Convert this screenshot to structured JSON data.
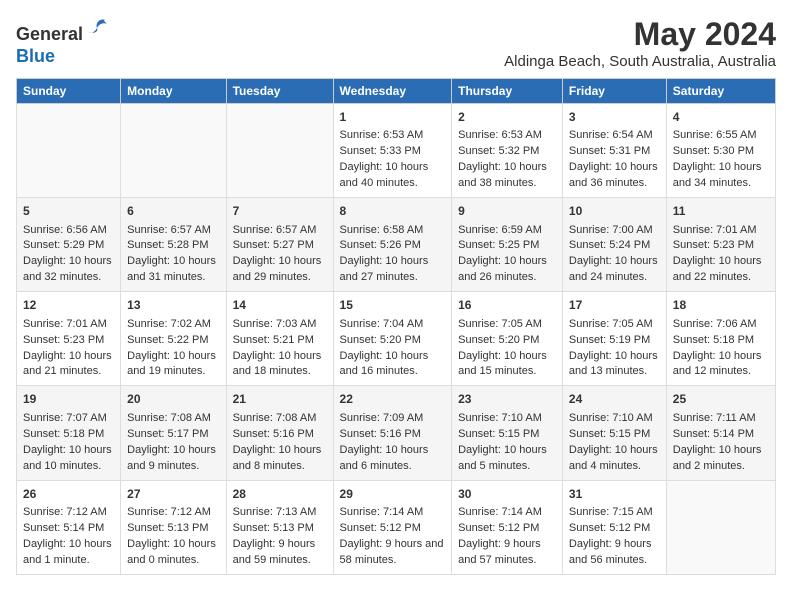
{
  "header": {
    "logo_line1": "General",
    "logo_line2": "Blue",
    "month_year": "May 2024",
    "location": "Aldinga Beach, South Australia, Australia"
  },
  "days_of_week": [
    "Sunday",
    "Monday",
    "Tuesday",
    "Wednesday",
    "Thursday",
    "Friday",
    "Saturday"
  ],
  "weeks": [
    [
      {
        "num": "",
        "sunrise": "",
        "sunset": "",
        "daylight": ""
      },
      {
        "num": "",
        "sunrise": "",
        "sunset": "",
        "daylight": ""
      },
      {
        "num": "",
        "sunrise": "",
        "sunset": "",
        "daylight": ""
      },
      {
        "num": "1",
        "sunrise": "Sunrise: 6:53 AM",
        "sunset": "Sunset: 5:33 PM",
        "daylight": "Daylight: 10 hours and 40 minutes."
      },
      {
        "num": "2",
        "sunrise": "Sunrise: 6:53 AM",
        "sunset": "Sunset: 5:32 PM",
        "daylight": "Daylight: 10 hours and 38 minutes."
      },
      {
        "num": "3",
        "sunrise": "Sunrise: 6:54 AM",
        "sunset": "Sunset: 5:31 PM",
        "daylight": "Daylight: 10 hours and 36 minutes."
      },
      {
        "num": "4",
        "sunrise": "Sunrise: 6:55 AM",
        "sunset": "Sunset: 5:30 PM",
        "daylight": "Daylight: 10 hours and 34 minutes."
      }
    ],
    [
      {
        "num": "5",
        "sunrise": "Sunrise: 6:56 AM",
        "sunset": "Sunset: 5:29 PM",
        "daylight": "Daylight: 10 hours and 32 minutes."
      },
      {
        "num": "6",
        "sunrise": "Sunrise: 6:57 AM",
        "sunset": "Sunset: 5:28 PM",
        "daylight": "Daylight: 10 hours and 31 minutes."
      },
      {
        "num": "7",
        "sunrise": "Sunrise: 6:57 AM",
        "sunset": "Sunset: 5:27 PM",
        "daylight": "Daylight: 10 hours and 29 minutes."
      },
      {
        "num": "8",
        "sunrise": "Sunrise: 6:58 AM",
        "sunset": "Sunset: 5:26 PM",
        "daylight": "Daylight: 10 hours and 27 minutes."
      },
      {
        "num": "9",
        "sunrise": "Sunrise: 6:59 AM",
        "sunset": "Sunset: 5:25 PM",
        "daylight": "Daylight: 10 hours and 26 minutes."
      },
      {
        "num": "10",
        "sunrise": "Sunrise: 7:00 AM",
        "sunset": "Sunset: 5:24 PM",
        "daylight": "Daylight: 10 hours and 24 minutes."
      },
      {
        "num": "11",
        "sunrise": "Sunrise: 7:01 AM",
        "sunset": "Sunset: 5:23 PM",
        "daylight": "Daylight: 10 hours and 22 minutes."
      }
    ],
    [
      {
        "num": "12",
        "sunrise": "Sunrise: 7:01 AM",
        "sunset": "Sunset: 5:23 PM",
        "daylight": "Daylight: 10 hours and 21 minutes."
      },
      {
        "num": "13",
        "sunrise": "Sunrise: 7:02 AM",
        "sunset": "Sunset: 5:22 PM",
        "daylight": "Daylight: 10 hours and 19 minutes."
      },
      {
        "num": "14",
        "sunrise": "Sunrise: 7:03 AM",
        "sunset": "Sunset: 5:21 PM",
        "daylight": "Daylight: 10 hours and 18 minutes."
      },
      {
        "num": "15",
        "sunrise": "Sunrise: 7:04 AM",
        "sunset": "Sunset: 5:20 PM",
        "daylight": "Daylight: 10 hours and 16 minutes."
      },
      {
        "num": "16",
        "sunrise": "Sunrise: 7:05 AM",
        "sunset": "Sunset: 5:20 PM",
        "daylight": "Daylight: 10 hours and 15 minutes."
      },
      {
        "num": "17",
        "sunrise": "Sunrise: 7:05 AM",
        "sunset": "Sunset: 5:19 PM",
        "daylight": "Daylight: 10 hours and 13 minutes."
      },
      {
        "num": "18",
        "sunrise": "Sunrise: 7:06 AM",
        "sunset": "Sunset: 5:18 PM",
        "daylight": "Daylight: 10 hours and 12 minutes."
      }
    ],
    [
      {
        "num": "19",
        "sunrise": "Sunrise: 7:07 AM",
        "sunset": "Sunset: 5:18 PM",
        "daylight": "Daylight: 10 hours and 10 minutes."
      },
      {
        "num": "20",
        "sunrise": "Sunrise: 7:08 AM",
        "sunset": "Sunset: 5:17 PM",
        "daylight": "Daylight: 10 hours and 9 minutes."
      },
      {
        "num": "21",
        "sunrise": "Sunrise: 7:08 AM",
        "sunset": "Sunset: 5:16 PM",
        "daylight": "Daylight: 10 hours and 8 minutes."
      },
      {
        "num": "22",
        "sunrise": "Sunrise: 7:09 AM",
        "sunset": "Sunset: 5:16 PM",
        "daylight": "Daylight: 10 hours and 6 minutes."
      },
      {
        "num": "23",
        "sunrise": "Sunrise: 7:10 AM",
        "sunset": "Sunset: 5:15 PM",
        "daylight": "Daylight: 10 hours and 5 minutes."
      },
      {
        "num": "24",
        "sunrise": "Sunrise: 7:10 AM",
        "sunset": "Sunset: 5:15 PM",
        "daylight": "Daylight: 10 hours and 4 minutes."
      },
      {
        "num": "25",
        "sunrise": "Sunrise: 7:11 AM",
        "sunset": "Sunset: 5:14 PM",
        "daylight": "Daylight: 10 hours and 2 minutes."
      }
    ],
    [
      {
        "num": "26",
        "sunrise": "Sunrise: 7:12 AM",
        "sunset": "Sunset: 5:14 PM",
        "daylight": "Daylight: 10 hours and 1 minute."
      },
      {
        "num": "27",
        "sunrise": "Sunrise: 7:12 AM",
        "sunset": "Sunset: 5:13 PM",
        "daylight": "Daylight: 10 hours and 0 minutes."
      },
      {
        "num": "28",
        "sunrise": "Sunrise: 7:13 AM",
        "sunset": "Sunset: 5:13 PM",
        "daylight": "Daylight: 9 hours and 59 minutes."
      },
      {
        "num": "29",
        "sunrise": "Sunrise: 7:14 AM",
        "sunset": "Sunset: 5:12 PM",
        "daylight": "Daylight: 9 hours and 58 minutes."
      },
      {
        "num": "30",
        "sunrise": "Sunrise: 7:14 AM",
        "sunset": "Sunset: 5:12 PM",
        "daylight": "Daylight: 9 hours and 57 minutes."
      },
      {
        "num": "31",
        "sunrise": "Sunrise: 7:15 AM",
        "sunset": "Sunset: 5:12 PM",
        "daylight": "Daylight: 9 hours and 56 minutes."
      },
      {
        "num": "",
        "sunrise": "",
        "sunset": "",
        "daylight": ""
      }
    ]
  ]
}
